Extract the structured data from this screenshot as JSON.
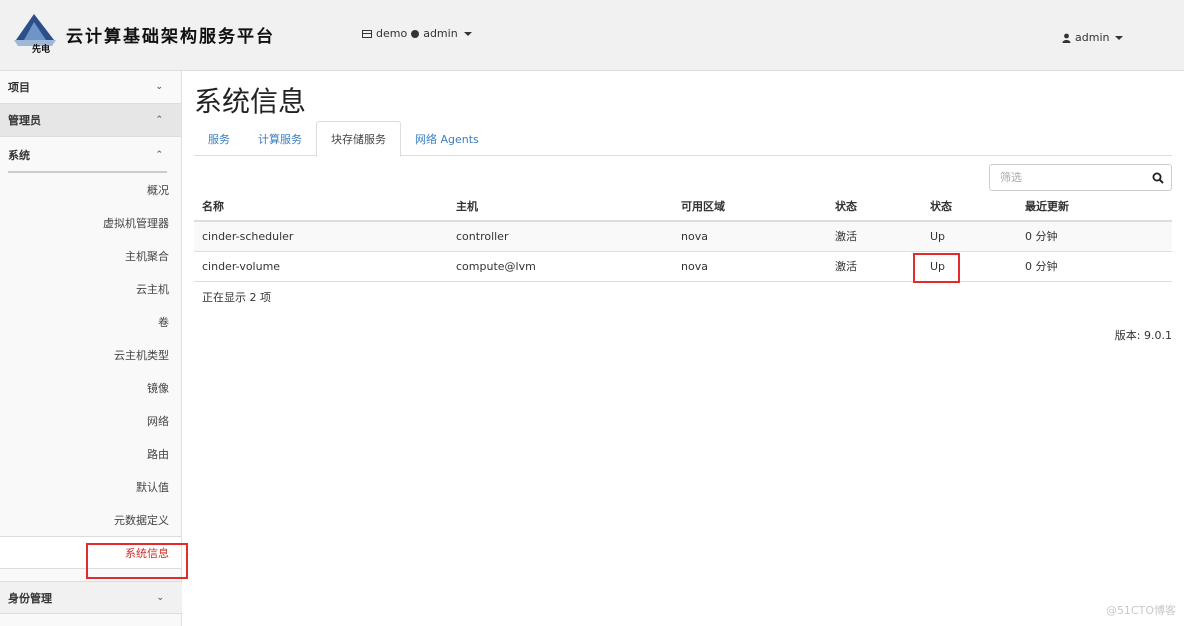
{
  "header": {
    "brand": "云计算基础架构服务平台",
    "logo_text": "先电",
    "project": "demo",
    "project_user": "admin",
    "user": "admin"
  },
  "sidebar": {
    "panels": {
      "project": "项目",
      "admin": "管理员",
      "system": "系统",
      "identity": "身份管理"
    },
    "items": [
      "概况",
      "虚拟机管理器",
      "主机聚合",
      "云主机",
      "卷",
      "云主机类型",
      "镜像",
      "网络",
      "路由",
      "默认值",
      "元数据定义",
      "系统信息"
    ]
  },
  "main": {
    "title": "系统信息",
    "tabs": [
      "服务",
      "计算服务",
      "块存储服务",
      "网络 Agents"
    ],
    "filter_placeholder": "筛选",
    "columns": [
      "名称",
      "主机",
      "可用区域",
      "状态",
      "状态",
      "最近更新"
    ],
    "rows": [
      [
        "cinder-scheduler",
        "controller",
        "nova",
        "激活",
        "Up",
        "0 分钟"
      ],
      [
        "cinder-volume",
        "compute@lvm",
        "nova",
        "激活",
        "Up",
        "0 分钟"
      ]
    ],
    "count_text": "正在显示 2 项",
    "version": "版本: 9.0.1"
  },
  "watermark": "@51CTO博客",
  "colors": {
    "accent": "#3a7fc0",
    "highlight": "#e32b2b",
    "active_item": "#c9302c"
  }
}
